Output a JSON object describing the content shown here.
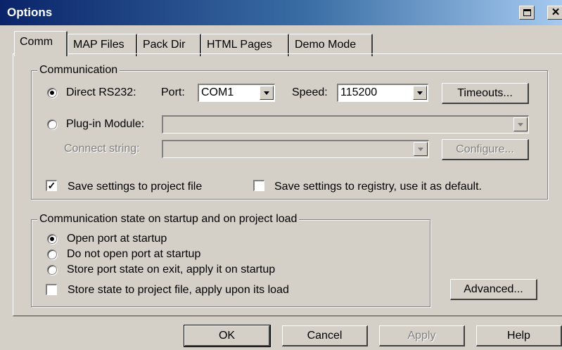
{
  "window": {
    "title": "Options",
    "title_bar_colors": [
      "#0a246a",
      "#3a6ea5",
      "#a6caf0"
    ],
    "face_color": "#d4d0c8",
    "buttons": [
      {
        "icon": "restore-icon"
      },
      {
        "icon": "close-icon",
        "glyph": "✕"
      }
    ]
  },
  "tabs": [
    {
      "label": "Comm",
      "active": true
    },
    {
      "label": "MAP Files"
    },
    {
      "label": "Pack Dir"
    },
    {
      "label": "HTML Pages"
    },
    {
      "label": "Demo Mode"
    }
  ],
  "communication": {
    "group_label": "Communication",
    "direct_rs232": {
      "label": "Direct RS232:",
      "checked": true
    },
    "port": {
      "label": "Port:",
      "value": "COM1"
    },
    "speed": {
      "label": "Speed:",
      "value": "115200"
    },
    "timeouts_button": "Timeouts...",
    "plugin_module": {
      "label": "Plug-in Module:",
      "checked": false,
      "value": ""
    },
    "connect_string": {
      "label": "Connect string:",
      "value": ""
    },
    "configure_button": "Configure...",
    "save_to_project": {
      "label": "Save settings to project file",
      "checked": true,
      "mark": "✓"
    },
    "save_to_registry": {
      "label": "Save settings to registry, use it as default.",
      "checked": false
    }
  },
  "startup": {
    "group_label": "Communication state on startup and on project load",
    "options": [
      {
        "label": "Open port at startup",
        "checked": true
      },
      {
        "label": "Do not open port at startup",
        "checked": false
      },
      {
        "label": "Store port state on exit, apply it on startup",
        "checked": false
      }
    ],
    "store_state": {
      "label": "Store state to project file, apply upon its load",
      "checked": false
    }
  },
  "advanced_button": "Advanced...",
  "footer": {
    "ok": "OK",
    "cancel": "Cancel",
    "apply": "Apply",
    "help": "Help"
  }
}
